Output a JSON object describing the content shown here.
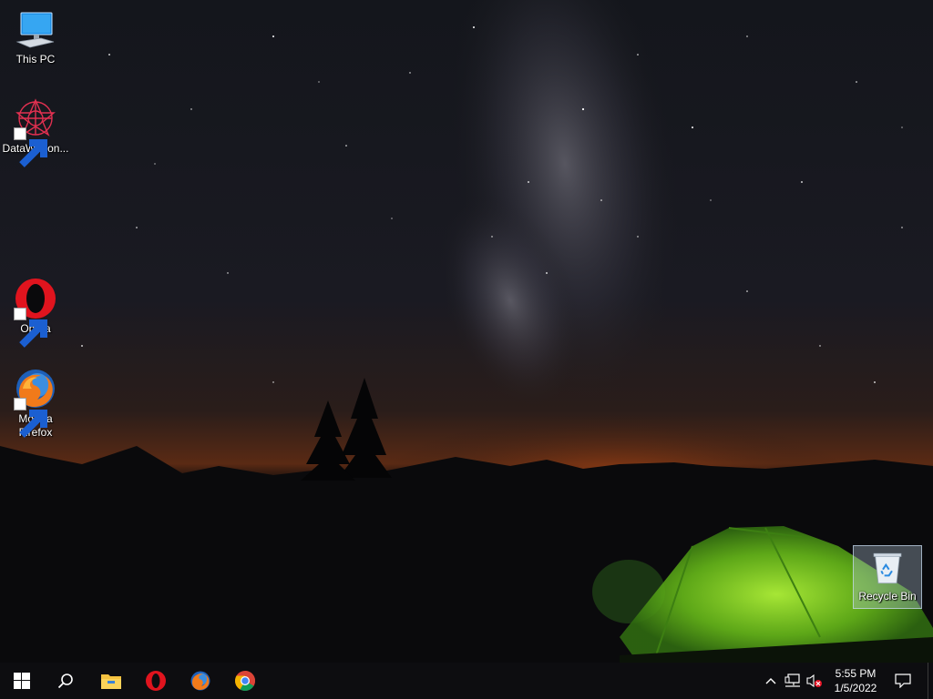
{
  "desktop": {
    "icons": [
      {
        "label": "This PC",
        "icon": "this-pc-icon"
      },
      {
        "label": "DataWagon...",
        "icon": "datawagon-icon"
      },
      {
        "label": "Opera",
        "icon": "opera-icon"
      },
      {
        "label": "Mozilla Firefox",
        "icon": "firefox-icon"
      },
      {
        "label": "Recycle Bin",
        "icon": "recycle-bin-icon"
      }
    ]
  },
  "taskbar": {
    "pinned": [
      {
        "name": "start",
        "icon": "windows-logo-icon"
      },
      {
        "name": "search",
        "icon": "search-icon"
      },
      {
        "name": "file-explorer",
        "icon": "folder-icon"
      },
      {
        "name": "opera",
        "icon": "opera-icon"
      },
      {
        "name": "firefox",
        "icon": "firefox-icon"
      },
      {
        "name": "chrome",
        "icon": "chrome-icon"
      }
    ],
    "tray": {
      "icons": [
        "chevron-up-icon",
        "network-icon",
        "volume-muted-icon"
      ],
      "time": "5:55 PM",
      "date": "1/5/2022"
    }
  },
  "colors": {
    "taskbar": "#0d0d10",
    "tent": "#8fdc2c",
    "horizon_glow": "#d9581a",
    "opera_red": "#e0141e"
  }
}
